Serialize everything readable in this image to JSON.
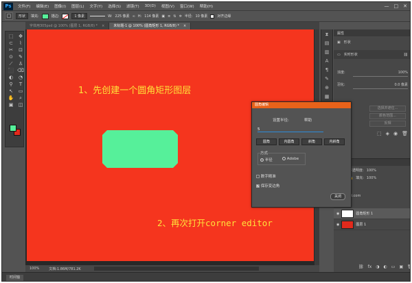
{
  "app": {
    "logo": "Ps"
  },
  "menu": [
    "文件(F)",
    "编辑(E)",
    "图像(I)",
    "图层(L)",
    "文字(Y)",
    "选择(S)",
    "滤镜(T)",
    "3D(D)",
    "视图(V)",
    "窗口(W)",
    "帮助(H)"
  ],
  "window_controls": [
    "—",
    "□",
    "✕"
  ],
  "options": {
    "mode": "形状",
    "fill_label": "填充:",
    "stroke_label": "描边:",
    "stroke_width": "1 像素",
    "w_label": "W:",
    "w_value": "225 像素",
    "h_label": "H:",
    "h_value": "114 像素",
    "radius_label": "半径:",
    "radius_value": "10 像素",
    "align_label": "对齐边缘"
  },
  "tabs": [
    {
      "label": "字体用305psd @ 100% (图层 1, RGB/8) *",
      "close": "×"
    },
    {
      "label": "未标题-1 @ 100% (圆角矩形 1, RGB/8) *",
      "close": "×"
    }
  ],
  "tools": [
    "⬚",
    "✥",
    "⊂",
    "⌇",
    "✂",
    "⊡",
    "⊙",
    "✎",
    "⟋",
    "♙",
    "⬛",
    "⌫",
    "◐",
    "◔",
    "⚲",
    "T",
    "↖",
    "▭",
    "✋",
    "⌕",
    "▣",
    "◫"
  ],
  "annotations": {
    "step1": "1、先创建一个圆角矩形图层",
    "step2": "2、再次打开corner editor"
  },
  "status": {
    "zoom": "100%",
    "doc": "文档:1.86M/781.2K"
  },
  "timeline": "时间轴",
  "properties": {
    "title": "属性",
    "sub": "形状",
    "layer_name": "实时形状",
    "opacity_label": "浓度:",
    "opacity": "100%",
    "feather_label": "羽化:",
    "feather": "0.0 像素",
    "buttons": [
      "选择并遮住...",
      "颜色范围...",
      "反相"
    ]
  },
  "layers": {
    "website": "bruzhaoli.com",
    "opacity_label": "不透明度:",
    "opacity": "100%",
    "fill_label": "填充:",
    "fill": "100%",
    "items": [
      {
        "name": "圆角矩形 1",
        "selected": true
      },
      {
        "name": "图层 1",
        "selected": false
      }
    ],
    "bottom_icons": [
      "⛓",
      "fx",
      "◑",
      "◐",
      "▭",
      "▣",
      "🗑"
    ]
  },
  "dialog": {
    "title": "圆角编辑",
    "radius_label": "设置半径:",
    "help": "帮助",
    "radius_value": "5",
    "buttons": [
      "圆角",
      "内圆角",
      "斜角",
      "内斜角"
    ],
    "style_label": "方式",
    "opt1": "半径",
    "opt2": "Adobe",
    "chk1": "数字精准",
    "chk2": "保存变边角",
    "close": "关闭"
  },
  "colors": {
    "fill": "#56f09a",
    "canvas": "#f5351e",
    "annotation": "#ffe23a",
    "dialog_title": "#e8621a"
  }
}
